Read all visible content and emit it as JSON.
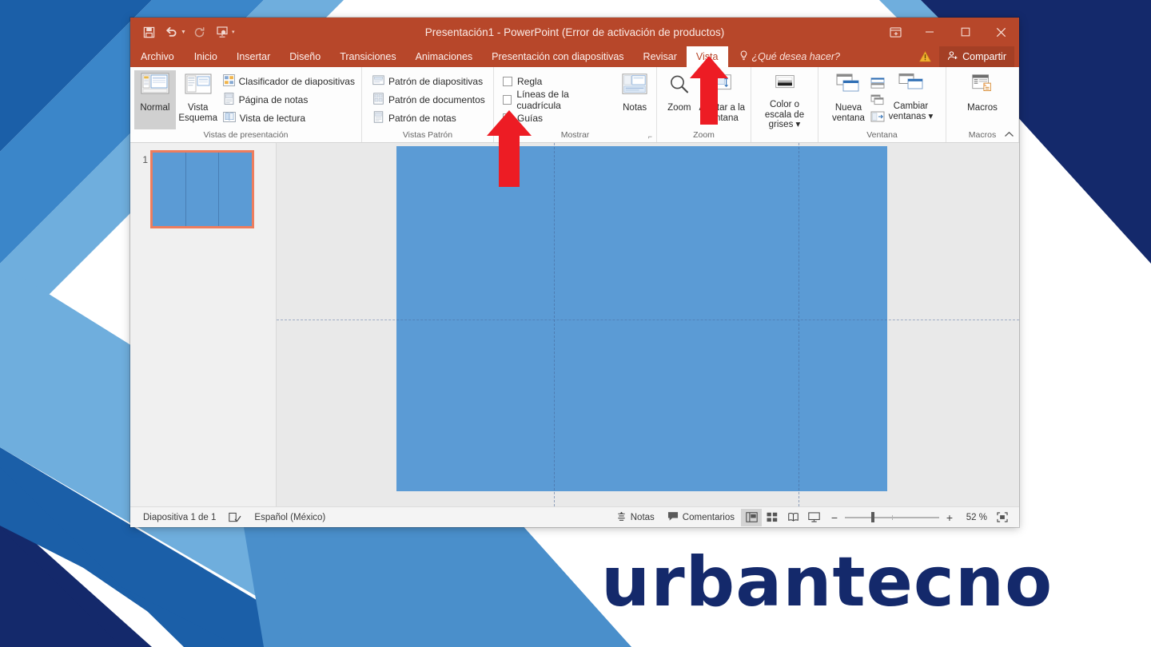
{
  "window": {
    "title": "Presentación1 - PowerPoint (Error de activación de productos)",
    "quick_access": [
      {
        "name": "save-icon",
        "label": "Guardar"
      },
      {
        "name": "undo-icon",
        "label": "Deshacer"
      },
      {
        "name": "redo-icon",
        "label": "Rehacer"
      },
      {
        "name": "start-slideshow-icon",
        "label": "Comenzar presentación con diapositivas"
      },
      {
        "name": "customize-qat-icon",
        "label": "Personalizar barra de herramientas de acceso rápido"
      }
    ],
    "controls": {
      "ribbon_display": "Opciones de presentación de la cinta de opciones",
      "minimize": "–",
      "maximize": "□",
      "close": "✕"
    }
  },
  "tabs": [
    {
      "label": "Archivo",
      "active": false
    },
    {
      "label": "Inicio",
      "active": false
    },
    {
      "label": "Insertar",
      "active": false
    },
    {
      "label": "Diseño",
      "active": false
    },
    {
      "label": "Transiciones",
      "active": false
    },
    {
      "label": "Animaciones",
      "active": false
    },
    {
      "label": "Presentación con diapositivas",
      "active": false
    },
    {
      "label": "Revisar",
      "active": false
    },
    {
      "label": "Vista",
      "active": true
    }
  ],
  "tell_me": "¿Qué desea hacer?",
  "share_label": "Compartir",
  "ribbon": {
    "groups": [
      {
        "label": "Vistas de presentación",
        "big_buttons": [
          {
            "label": "Normal",
            "selected": true
          },
          {
            "label": "Vista Esquema",
            "selected": false
          }
        ],
        "list_items": [
          "Clasificador de diapositivas",
          "Página de notas",
          "Vista de lectura"
        ]
      },
      {
        "label": "Vistas Patrón",
        "list_items": [
          "Patrón de diapositivas",
          "Patrón de documentos",
          "Patrón de notas"
        ]
      },
      {
        "label": "Mostrar",
        "checkboxes": [
          {
            "label": "Regla",
            "checked": false
          },
          {
            "label": "Líneas de la cuadrícula",
            "checked": false
          },
          {
            "label": "Guías",
            "checked": true
          }
        ],
        "big_buttons": [
          {
            "label": "Notas",
            "selected": false
          }
        ],
        "has_dialog_launcher": true
      },
      {
        "label": "Zoom",
        "big_buttons": [
          {
            "label": "Zoom",
            "selected": false
          },
          {
            "label": "Ajustar a la ventana",
            "selected": false
          }
        ]
      },
      {
        "label": "",
        "big_buttons": [
          {
            "label": "Color o escala de grises",
            "selected": false,
            "dropdown": true
          }
        ]
      },
      {
        "label": "Ventana",
        "big_buttons": [
          {
            "label": "Nueva ventana",
            "selected": false
          },
          {
            "label": "Cambiar ventanas",
            "selected": false,
            "dropdown": true
          }
        ],
        "icon_buttons": [
          "organizar-todo-icon",
          "cascada-icon",
          "mover-division-icon"
        ]
      },
      {
        "label": "Macros",
        "big_buttons": [
          {
            "label": "Macros",
            "selected": false
          }
        ]
      }
    ],
    "collapse_label": "Contraer la cinta de opciones"
  },
  "thumbnails": [
    {
      "number": "1",
      "selected": true
    }
  ],
  "slide": {
    "fill_color": "#5B9BD5",
    "guides": {
      "vertical_count": 2,
      "horizontal_count": 1
    }
  },
  "status_bar": {
    "slide_count": "Diapositiva 1 de 1",
    "language": "Español (México)",
    "notes_label": "Notas",
    "comments_label": "Comentarios",
    "views": [
      {
        "name": "view-normal",
        "selected": true
      },
      {
        "name": "view-slide-sorter",
        "selected": false
      },
      {
        "name": "view-reading",
        "selected": false
      },
      {
        "name": "view-slideshow",
        "selected": false
      }
    ],
    "zoom_out": "−",
    "zoom_in": "+",
    "zoom_level": "52 %",
    "fit_label": "Ajustar diapositiva a la ventana actual"
  },
  "annotations": {
    "arrow_1_points_to": "Guías",
    "arrow_2_points_to": "Vista"
  },
  "branding": {
    "logo_text": "urbantecno",
    "logo_color": "#14296B"
  },
  "colors": {
    "accent": "#B7472A",
    "slide_blue": "#5B9BD5",
    "thumb_select": "#ED7D5E",
    "arrow_red": "#ED1C24"
  }
}
